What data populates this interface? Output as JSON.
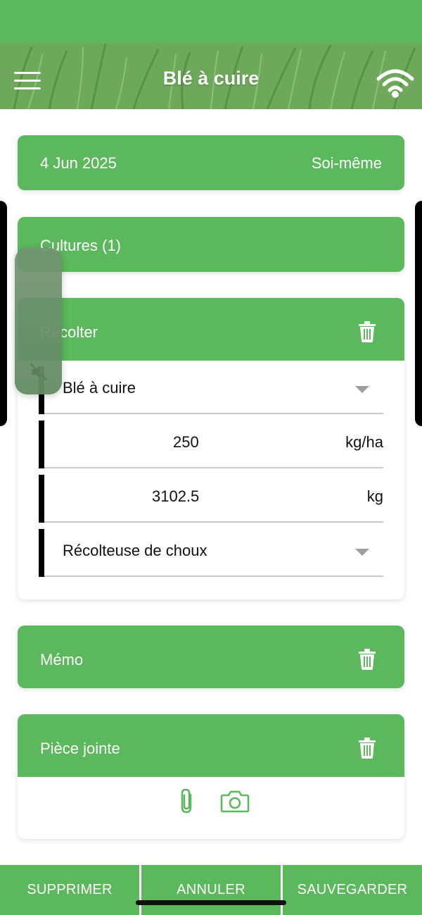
{
  "header": {
    "title": "Blé à cuire",
    "menu_icon": "hamburger-menu-icon",
    "status_icon": "wifi-icon",
    "color": "#5cb85c"
  },
  "date_card": {
    "date": "4 Jun 2025",
    "operator": "Soi-même"
  },
  "cultures": {
    "label": "Cultures (1)"
  },
  "recolter": {
    "label": "Récolter",
    "fields": [
      {
        "value": "Blé à cuire",
        "kind": "select"
      },
      {
        "value": "250",
        "unit": "kg/ha"
      },
      {
        "value": "3102.5",
        "unit": "kg"
      },
      {
        "value": "Récolteuse de choux",
        "kind": "select"
      }
    ]
  },
  "memo": {
    "label": "Mémo"
  },
  "attachment": {
    "label": "Pièce jointe",
    "icons": [
      "paperclip-icon",
      "camera-icon"
    ]
  },
  "toolbar": {
    "delete_label": "SUPPRIMER",
    "cancel_label": "ANNULER",
    "save_label": "SAUVEGARDER"
  },
  "volume_hud": {
    "state": "muted",
    "icon": "speaker-muted-icon"
  }
}
